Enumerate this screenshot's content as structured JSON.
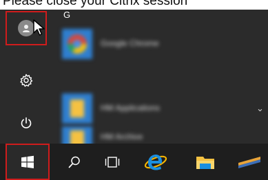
{
  "caption": {
    "text": "Please close your Citrix session"
  },
  "rail": {
    "account": {
      "icon": "user-avatar-icon"
    },
    "settings": {
      "icon": "gear-icon"
    },
    "power": {
      "icon": "power-icon"
    }
  },
  "app_list": {
    "section_letter": "G",
    "apps": [
      {
        "name": "Google Chrome",
        "icon": "chrome-icon"
      },
      {
        "name": "HM Applications",
        "icon": "folder-icon"
      },
      {
        "name": "HM Archive",
        "icon": "folder-icon"
      }
    ],
    "expand_icon": "chevron-down-icon"
  },
  "taskbar": {
    "start": {
      "icon": "windows-logo-icon"
    },
    "search": {
      "icon": "search-icon"
    },
    "task_view": {
      "icon": "task-view-icon"
    },
    "items": [
      {
        "icon": "internet-explorer-icon"
      },
      {
        "icon": "file-explorer-icon"
      },
      {
        "icon": "pinned-app-icon"
      }
    ]
  },
  "colors": {
    "start_bg": "#2b2b2b",
    "taskbar_bg": "#1e1e1e",
    "highlight": "#d01c1c",
    "ie_blue": "#1b8fe0",
    "folder_yellow": "#f5c242"
  }
}
